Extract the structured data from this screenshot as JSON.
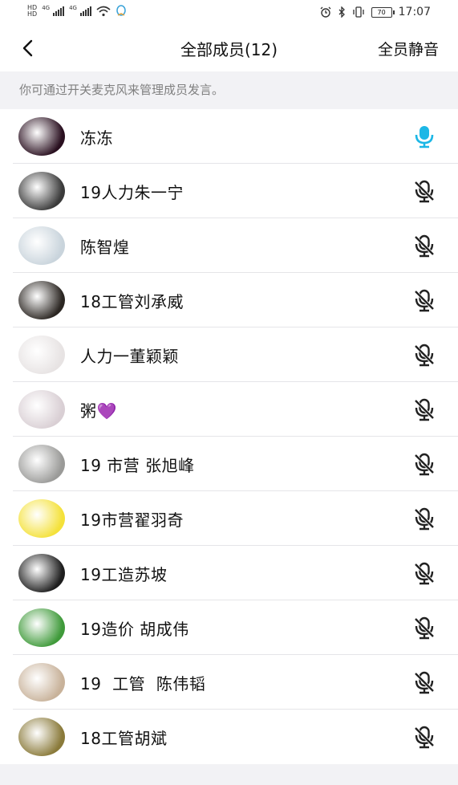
{
  "status_bar": {
    "network_left": "4G",
    "network_right": "4G",
    "battery": "70",
    "time": "17:07"
  },
  "nav": {
    "title": "全部成员(12)",
    "action": "全员静音"
  },
  "hint": "你可通过开关麦克风来管理成员发言。",
  "colors": {
    "mic_active": "#1cb7e6",
    "mic_muted": "#222222"
  },
  "members": [
    {
      "name": "冻冻",
      "mic": "on",
      "avatar_color": "#2a1020"
    },
    {
      "name": "19人力朱一宁",
      "mic": "off",
      "avatar_color": "#3a3a3a"
    },
    {
      "name": "陈智煌",
      "mic": "off",
      "avatar_color": "#c9d4dc"
    },
    {
      "name": "18工管刘承威",
      "mic": "off",
      "avatar_color": "#2b2622"
    },
    {
      "name": "人力一董颖颖",
      "mic": "off",
      "avatar_color": "#e7e3e3"
    },
    {
      "name": "粥",
      "emoji": "💜",
      "mic": "off",
      "avatar_color": "#d9cfd4"
    },
    {
      "name": "19 市营 张旭峰",
      "mic": "off",
      "avatar_color": "#9a9a98"
    },
    {
      "name": "19市营翟羽奇",
      "mic": "off",
      "avatar_color": "#f4e13a"
    },
    {
      "name": "19工造苏坡",
      "mic": "off",
      "avatar_color": "#1e1e1e"
    },
    {
      "name": "19造价 胡成伟",
      "mic": "off",
      "avatar_color": "#3f9a3a"
    },
    {
      "name": "19  工管  陈伟韬",
      "mic": "off",
      "avatar_color": "#c8b29a"
    },
    {
      "name": "18工管胡斌",
      "mic": "off",
      "avatar_color": "#8a7a3a"
    }
  ]
}
